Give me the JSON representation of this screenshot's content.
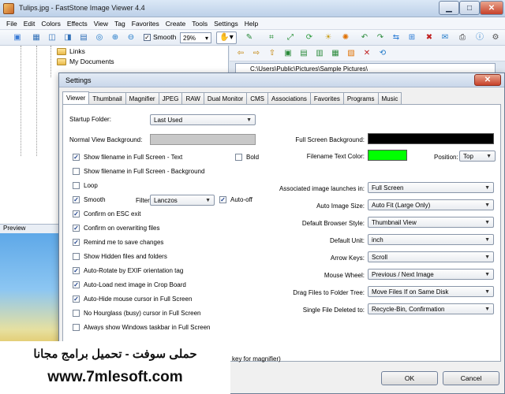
{
  "window": {
    "title": "Tulips.jpg  -  FastStone Image Viewer 4.4"
  },
  "menu": [
    "File",
    "Edit",
    "Colors",
    "Effects",
    "View",
    "Tag",
    "Favorites",
    "Create",
    "Tools",
    "Settings",
    "Help"
  ],
  "toolbar": {
    "smooth_label": "Smooth",
    "zoom_value": "29%"
  },
  "tree": {
    "items": [
      "Links",
      "My Documents"
    ]
  },
  "preview": {
    "label": "Preview"
  },
  "browser": {
    "path": "C:\\Users\\Public\\Pictures\\Sample Pictures\\"
  },
  "dialog": {
    "title": "Settings",
    "tabs": [
      "Viewer",
      "Thumbnail",
      "Magnifier",
      "JPEG",
      "RAW",
      "Dual Monitor",
      "CMS",
      "Associations",
      "Favorites",
      "Programs",
      "Music"
    ],
    "left": {
      "startup_folder_label": "Startup Folder:",
      "startup_folder_value": "Last Used",
      "normal_bg_label": "Normal View Background:",
      "bold_label": "Bold",
      "filter_label": "Filter",
      "filter_value": "Lanczos",
      "auto_off_label": "Auto-off",
      "checkboxes": [
        {
          "label": "Show  filename in Full Screen - Text",
          "checked": true
        },
        {
          "label": "Show  filename in Full Screen - Background",
          "checked": false
        },
        {
          "label": "Loop",
          "checked": false
        },
        {
          "label": "Smooth",
          "checked": true
        },
        {
          "label": "Confirm on ESC exit",
          "checked": true
        },
        {
          "label": "Confirm on overwriting files",
          "checked": true
        },
        {
          "label": "Remind me to save changes",
          "checked": true
        },
        {
          "label": "Show Hidden files and folders",
          "checked": false
        },
        {
          "label": "Auto-Rotate by EXIF orientation tag",
          "checked": true
        },
        {
          "label": "Auto-Load next image in Crop Board",
          "checked": true
        },
        {
          "label": "Auto-Hide mouse cursor in Full Screen",
          "checked": true
        },
        {
          "label": "No Hourglass (busy) cursor in Full Screen",
          "checked": false
        },
        {
          "label": "Always show Windows taskbar in Full Screen",
          "checked": false
        }
      ],
      "magnifier_hint": "key for magnifier)"
    },
    "right": {
      "full_screen_bg_label": "Full Screen Background:",
      "full_screen_bg_color": "#000000",
      "filename_text_color_label": "Filename Text Color:",
      "filename_text_color": "#00ff00",
      "position_label": "Position:",
      "position_value": "Top",
      "rows": [
        {
          "label": "Associated image launches in:",
          "value": "Full Screen"
        },
        {
          "label": "Auto Image Size:",
          "value": "Auto Fit (Large Only)"
        },
        {
          "label": "Default Browser Style:",
          "value": "Thumbnail View"
        },
        {
          "label": "Default Unit:",
          "value": "inch"
        },
        {
          "label": "Arrow Keys:",
          "value": "Scroll"
        },
        {
          "label": "Mouse Wheel:",
          "value": "Previous / Next Image"
        },
        {
          "label": "Drag Files to Folder Tree:",
          "value": "Move Files If on Same Disk"
        },
        {
          "label": "Single File Deleted to:",
          "value": "Recycle-Bin, Confirmation"
        }
      ]
    },
    "buttons": {
      "ok": "OK",
      "cancel": "Cancel"
    }
  },
  "watermark": {
    "arabic": "حملى سوفت - تحميل برامج مجانا",
    "url": "www.7mlesoft.com"
  }
}
